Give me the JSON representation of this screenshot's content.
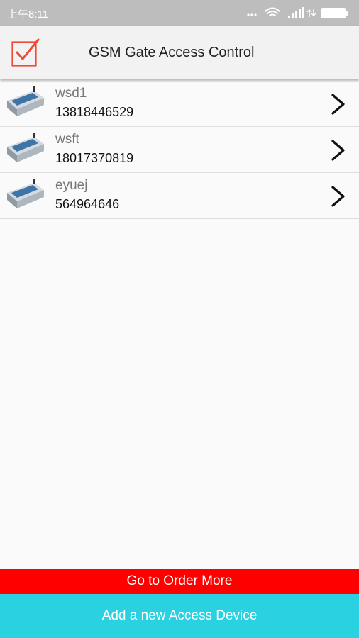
{
  "status_bar": {
    "time": "上午8:11",
    "icons": [
      "more-icon",
      "wifi-icon",
      "signal-icon",
      "network-type-icon",
      "battery-icon"
    ]
  },
  "header": {
    "title": "GSM Gate Access Control",
    "logo_icon": "checkbox-check-icon",
    "accent_color": "#f04a36"
  },
  "devices": [
    {
      "name": "wsd1",
      "phone": "13818446529"
    },
    {
      "name": "wsft",
      "phone": "18017370819"
    },
    {
      "name": "eyuej",
      "phone": "564964646"
    }
  ],
  "footer": {
    "order_label": "Go to Order More",
    "order_color": "#ff0000",
    "add_label": "Add a new Access Device",
    "add_color": "#29d1e1"
  }
}
